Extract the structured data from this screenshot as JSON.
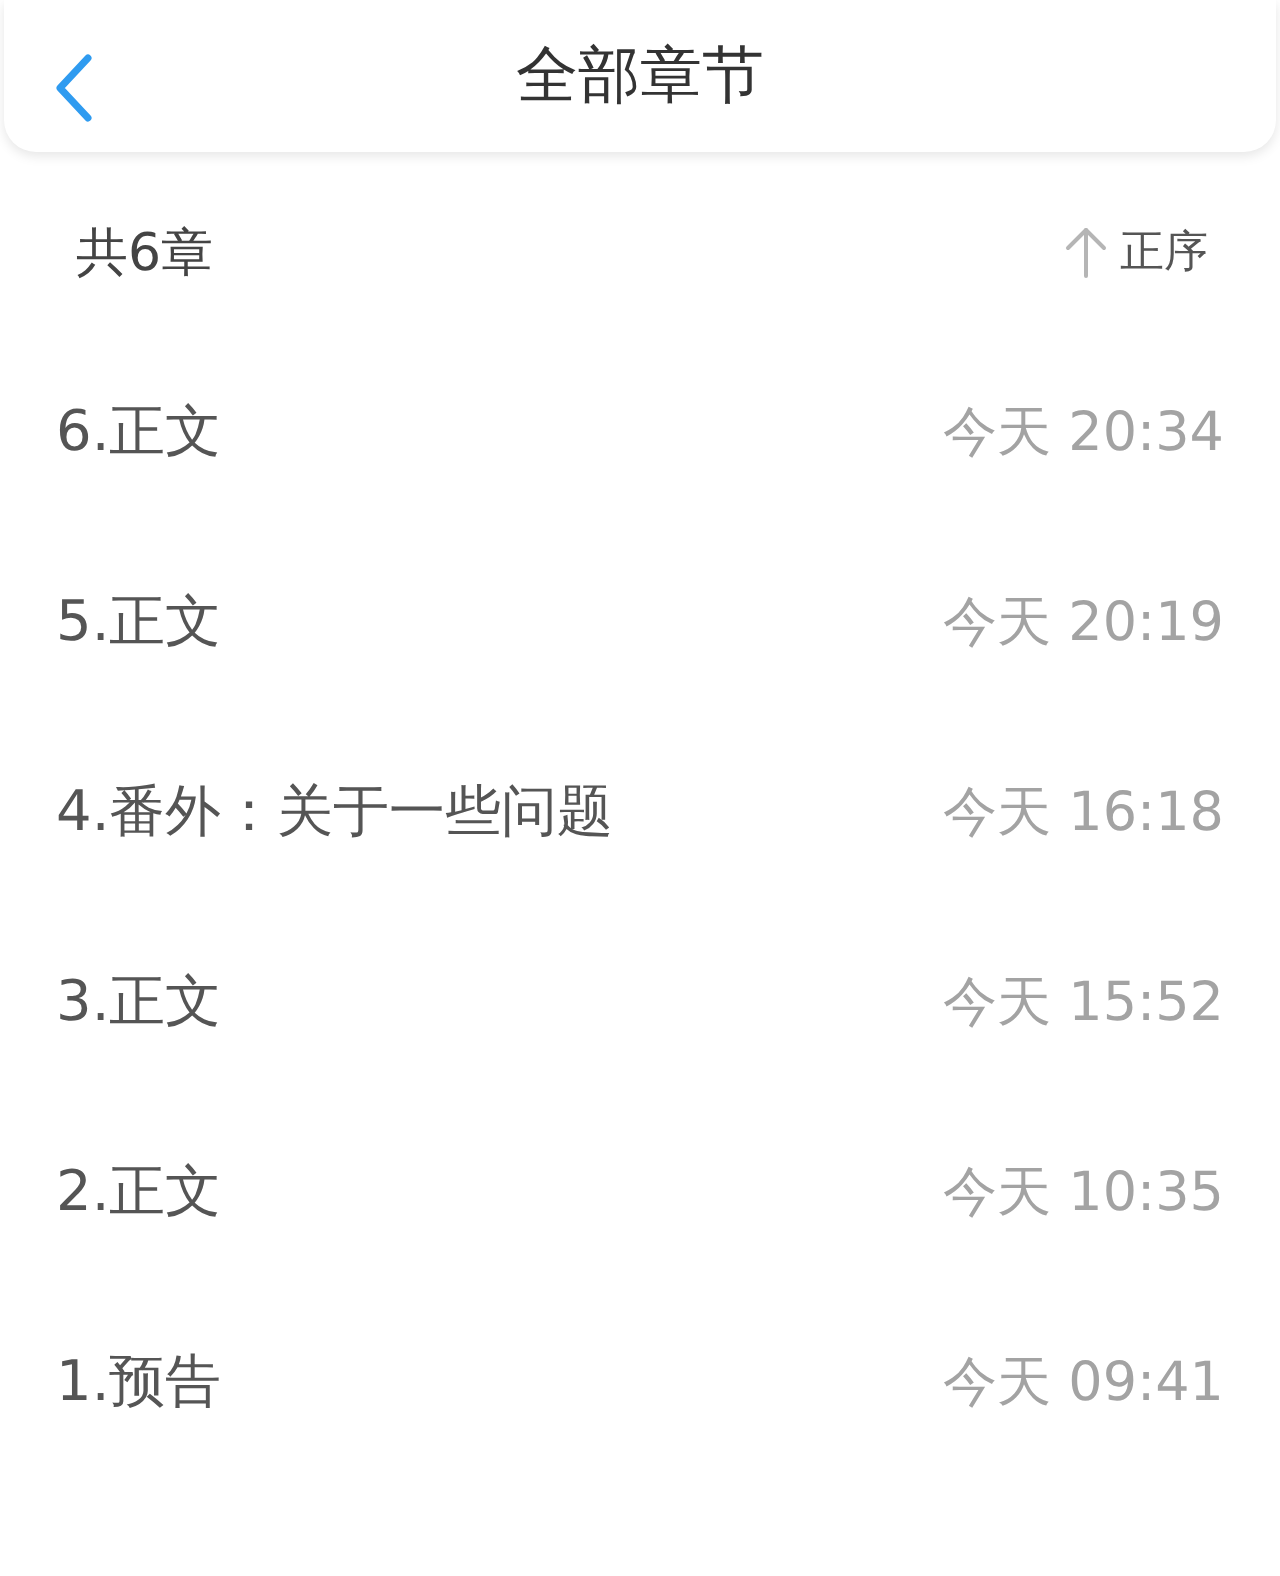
{
  "header": {
    "title": "全部章节"
  },
  "summary": {
    "count": "共6章",
    "sort_label": "正序"
  },
  "chapters": [
    {
      "title": "6.正文",
      "time": "今天 20:34"
    },
    {
      "title": "5.正文",
      "time": "今天 20:19"
    },
    {
      "title": "4.番外：关于一些问题",
      "time": "今天 16:18"
    },
    {
      "title": "3.正文",
      "time": "今天 15:52"
    },
    {
      "title": "2.正文",
      "time": "今天 10:35"
    },
    {
      "title": "1.预告",
      "time": "今天 09:41"
    }
  ]
}
